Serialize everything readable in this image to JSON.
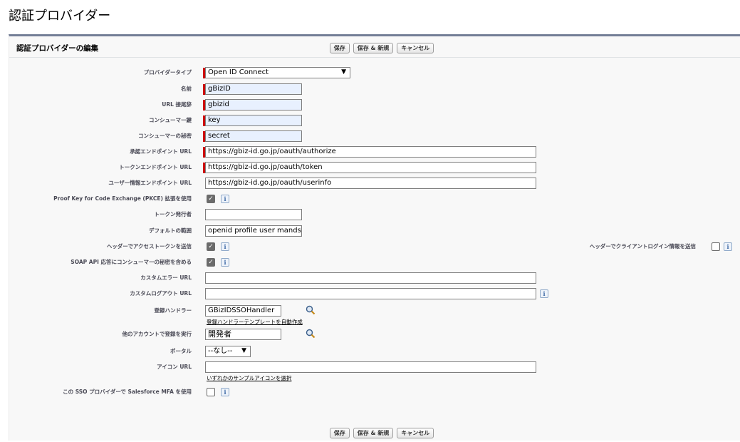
{
  "page": {
    "title": "認証プロバイダー"
  },
  "panel": {
    "title": "認証プロバイダーの編集"
  },
  "buttons": {
    "save": "保存",
    "save_new": "保存 & 新規",
    "cancel": "キャンセル"
  },
  "form": {
    "provider_type": {
      "label": "プロバイダータイプ",
      "value": "Open ID Connect"
    },
    "name": {
      "label": "名前",
      "value": "gBizID"
    },
    "url_suffix": {
      "label": "URL 接尾辞",
      "value": "gbizid"
    },
    "consumer_key": {
      "label": "コンシューマー鍵",
      "value": "key"
    },
    "consumer_secret": {
      "label": "コンシューマーの秘密",
      "value": "secret"
    },
    "authorize_url": {
      "label": "承認エンドポイント URL",
      "value": "https://gbiz-id.go.jp/oauth/authorize"
    },
    "token_url": {
      "label": "トークンエンドポイント URL",
      "value": "https://gbiz-id.go.jp/oauth/token"
    },
    "userinfo_url": {
      "label": "ユーザー情報エンドポイント URL",
      "value": "https://gbiz-id.go.jp/oauth/userinfo"
    },
    "pkce": {
      "label": "Proof Key for Code Exchange (PKCE) 拡張を使用",
      "checked": true
    },
    "token_issuer": {
      "label": "トークン発行者",
      "value": ""
    },
    "default_scopes": {
      "label": "デフォルトの範囲",
      "value": "openid profile user mands"
    },
    "send_access_token_header": {
      "label": "ヘッダーでアクセストークンを送信",
      "checked": true
    },
    "send_client_credentials_header": {
      "label": "ヘッダーでクライアントログイン情報を送信",
      "checked": false
    },
    "include_consumer_secret_soap": {
      "label": "SOAP API 応答にコンシューマーの秘密を含める",
      "checked": true
    },
    "custom_error_url": {
      "label": "カスタムエラー URL",
      "value": ""
    },
    "custom_logout_url": {
      "label": "カスタムログアウト URL",
      "value": ""
    },
    "registration_handler": {
      "label": "登録ハンドラー",
      "value": "GBizIDSSOHandler",
      "link": "登録ハンドラーテンプレートを自動作成"
    },
    "execute_registration_as": {
      "label": "他のアカウントで登録を実行",
      "value": "開発者"
    },
    "portal": {
      "label": "ポータル",
      "value": "--なし--"
    },
    "icon_url": {
      "label": "アイコン URL",
      "value": "",
      "link": "いずれかのサンプルアイコンを選択"
    },
    "use_salesforce_mfa": {
      "label": "この SSO プロバイダーで Salesforce MFA を使用",
      "checked": false
    }
  },
  "icons": {
    "info": "i",
    "check": "✓",
    "caret": "⌄"
  }
}
